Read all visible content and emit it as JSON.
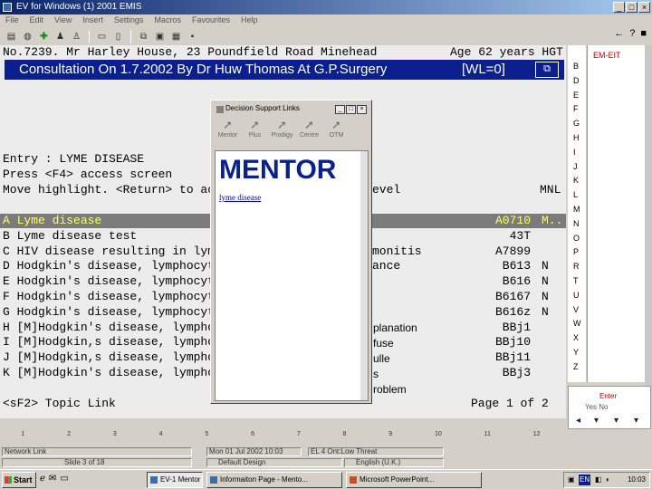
{
  "window": {
    "title": "EV for Windows (1) 2001 EMIS",
    "buttons": [
      "_",
      "□",
      "×"
    ]
  },
  "menu": [
    "File",
    "Edit",
    "View",
    "Insert",
    "Settings",
    "Macros",
    "Favourites",
    "Help"
  ],
  "toolbar_icons": [
    "print-icon",
    "globe-icon",
    "add-icon",
    "users-icon",
    "person-icon",
    "doc-icon",
    "page-icon",
    "copy-icon",
    "paste-icon",
    "tray-icon",
    "save-icon"
  ],
  "toolbar_right": [
    "←",
    "?",
    "■"
  ],
  "terminal": {
    "patient_line": "No.7239. Mr Harley House, 23 Poundfield Road Minehead",
    "age": "Age 62 years HGT",
    "consultation": "Consultation On 1.7.2002 By Dr Huw Thomas At G.P.Surgery",
    "wl": "[WL=0]",
    "entry": "Entry : LYME DISEASE",
    "press": "Press <F4> access screen",
    "move": "Move highlight. <Return> to ac",
    "level": "evel",
    "mnl": "MNL",
    "footer_left": "<sF2> Topic Link",
    "footer_right": "Page 1 of 2",
    "rows": [
      {
        "text": "A Lyme disease",
        "code": "A0710",
        "flag": "M..",
        "highlight": true
      },
      {
        "text": "B Lyme disease test",
        "code": "43T",
        "flag": ""
      },
      {
        "text": "C HIV disease resulting in lym",
        "tail": "monitis",
        "code": "A7899",
        "flag": ""
      },
      {
        "text": "D Hodgkin's disease, lymphocyt",
        "tail": "ance",
        "code": "B613",
        "flag": "N"
      },
      {
        "text": "E Hodgkin's disease, lymphocyt",
        "code": "B616",
        "flag": "N"
      },
      {
        "text": "F Hodgkin's disease, lymphocyt",
        "code": "B6167",
        "flag": "N"
      },
      {
        "text": "G Hodgkin's disease, lymphocyt",
        "code": "B616z",
        "flag": "N"
      },
      {
        "text": "H [M]Hodgkin's disease, lympho",
        "code": "BBj1",
        "flag": ""
      },
      {
        "text": "I [M]Hodgkin,s disease, lympho",
        "code": "BBj10",
        "flag": ""
      },
      {
        "text": "J [M]Hodgkin,s disease, lympho",
        "code": "BBj11",
        "flag": ""
      },
      {
        "text": "K [M]Hodgkin's disease, lympho",
        "code": "BBj3",
        "flag": ""
      }
    ],
    "ghost_words": [
      "planation",
      "fuse",
      "ulle",
      "s",
      "roblem"
    ]
  },
  "letters": [
    "B",
    "D",
    "E",
    "F",
    "G",
    "H",
    "I",
    "J",
    "K",
    "L",
    "M",
    "N",
    "O",
    "P",
    "R",
    "T",
    "U",
    "V",
    "W",
    "X",
    "Y",
    "Z"
  ],
  "right_panel": {
    "header": "EM-EIT"
  },
  "enter_box": {
    "line1": "Enter",
    "line2": "Yes   No"
  },
  "dialog": {
    "title": "Decision Support Links",
    "buttons": [
      "_",
      "□",
      "×"
    ],
    "tools": [
      {
        "label": "Mentor",
        "icon": "arrow-icon"
      },
      {
        "label": "Plus",
        "icon": "arrow-icon"
      },
      {
        "label": "Prodigy",
        "icon": "arrow-icon"
      },
      {
        "label": "Centre",
        "icon": "arrow-icon"
      },
      {
        "label": "OTM",
        "icon": "arrow-icon"
      }
    ],
    "heading": "MENTOR",
    "link": "lyme disease"
  },
  "statusbar": {
    "fkeys": [
      "1",
      "2",
      "3",
      "4",
      "5",
      "6",
      "7",
      "8",
      "9",
      "10",
      "11",
      "12"
    ],
    "row1": [
      "Network Link",
      "Mon 01 Jul 2002 10:03",
      "EL 4 Ont:Low Threat"
    ],
    "row2": [
      "Slide 3 of 18",
      "Default Design",
      "English (U.K.)"
    ]
  },
  "taskbar": {
    "start": "Start",
    "tasks": [
      {
        "label": "EV-1 Mentor",
        "active": true
      },
      {
        "label": "Informaiton Page - Mento...",
        "active": false
      },
      {
        "label": "Microsoft PowerPoint...",
        "active": false
      }
    ],
    "tray_lang": "EN",
    "clock": "10:03"
  }
}
